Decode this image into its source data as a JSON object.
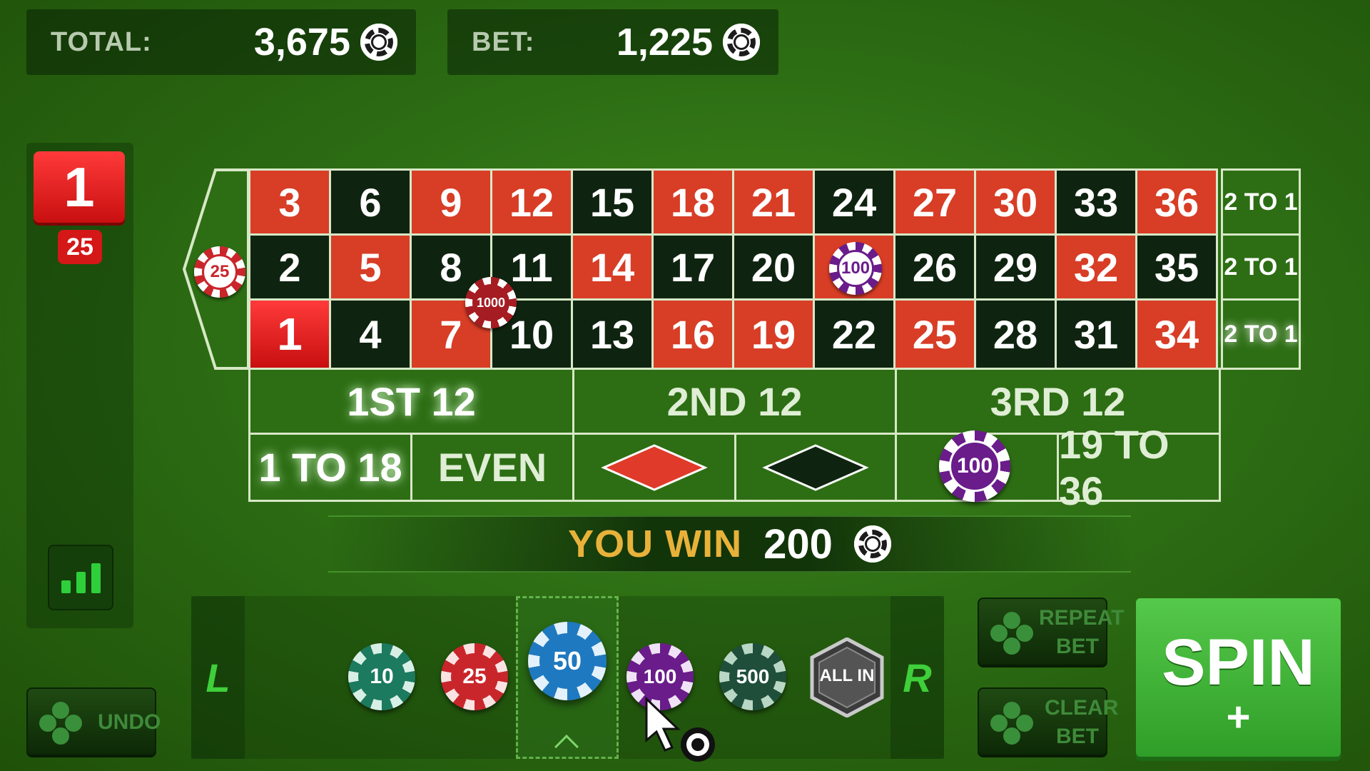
{
  "header": {
    "total_label": "TOTAL:",
    "total_value": "3,675",
    "bet_label": "BET:",
    "bet_value": "1,225"
  },
  "history": {
    "last_number": "1",
    "last_amount": "25"
  },
  "grid": {
    "top_row": [
      "3",
      "6",
      "9",
      "12",
      "15",
      "18",
      "21",
      "24",
      "27",
      "30",
      "33",
      "36"
    ],
    "top_colors": [
      "red",
      "black",
      "red",
      "red",
      "black",
      "red",
      "red",
      "black",
      "red",
      "red",
      "black",
      "red"
    ],
    "mid_row": [
      "2",
      "5",
      "8",
      "11",
      "14",
      "17",
      "20",
      "23",
      "26",
      "29",
      "32",
      "35"
    ],
    "mid_colors": [
      "black",
      "red",
      "black",
      "black",
      "red",
      "black",
      "black",
      "red",
      "black",
      "black",
      "red",
      "black"
    ],
    "bot_row": [
      "1",
      "4",
      "7",
      "10",
      "13",
      "16",
      "19",
      "22",
      "25",
      "28",
      "31",
      "34"
    ],
    "bot_colors": [
      "red",
      "black",
      "red",
      "black",
      "black",
      "red",
      "red",
      "black",
      "red",
      "black",
      "black",
      "red"
    ],
    "column_bets": [
      "2 TO 1",
      "2 TO 1",
      "2 TO 1"
    ],
    "dozens": [
      "1ST 12",
      "2ND 12",
      "3RD 12"
    ],
    "low": "1 TO 18",
    "even": "EVEN",
    "high": "19 TO 36"
  },
  "placed_chips": {
    "zero": "25",
    "corner_8_11": "1000",
    "on_23": "100",
    "on_odd": "100"
  },
  "win": {
    "label": "YOU WIN",
    "amount": "200"
  },
  "chips": [
    "10",
    "25",
    "50",
    "100",
    "500"
  ],
  "all_in_label": "ALL IN",
  "nav": {
    "left": "L",
    "right": "R"
  },
  "buttons": {
    "undo": "UNDO",
    "repeat_line1": "REPEAT",
    "repeat_line2": "BET",
    "clear_line1": "CLEAR",
    "clear_line2": "BET",
    "spin": "SPIN"
  },
  "colors": {
    "felt": "#2d6e14",
    "red": "#d83d26",
    "black": "#0f2410",
    "accent_green": "#3fcf3a",
    "win_gold": "#e8b23a"
  }
}
